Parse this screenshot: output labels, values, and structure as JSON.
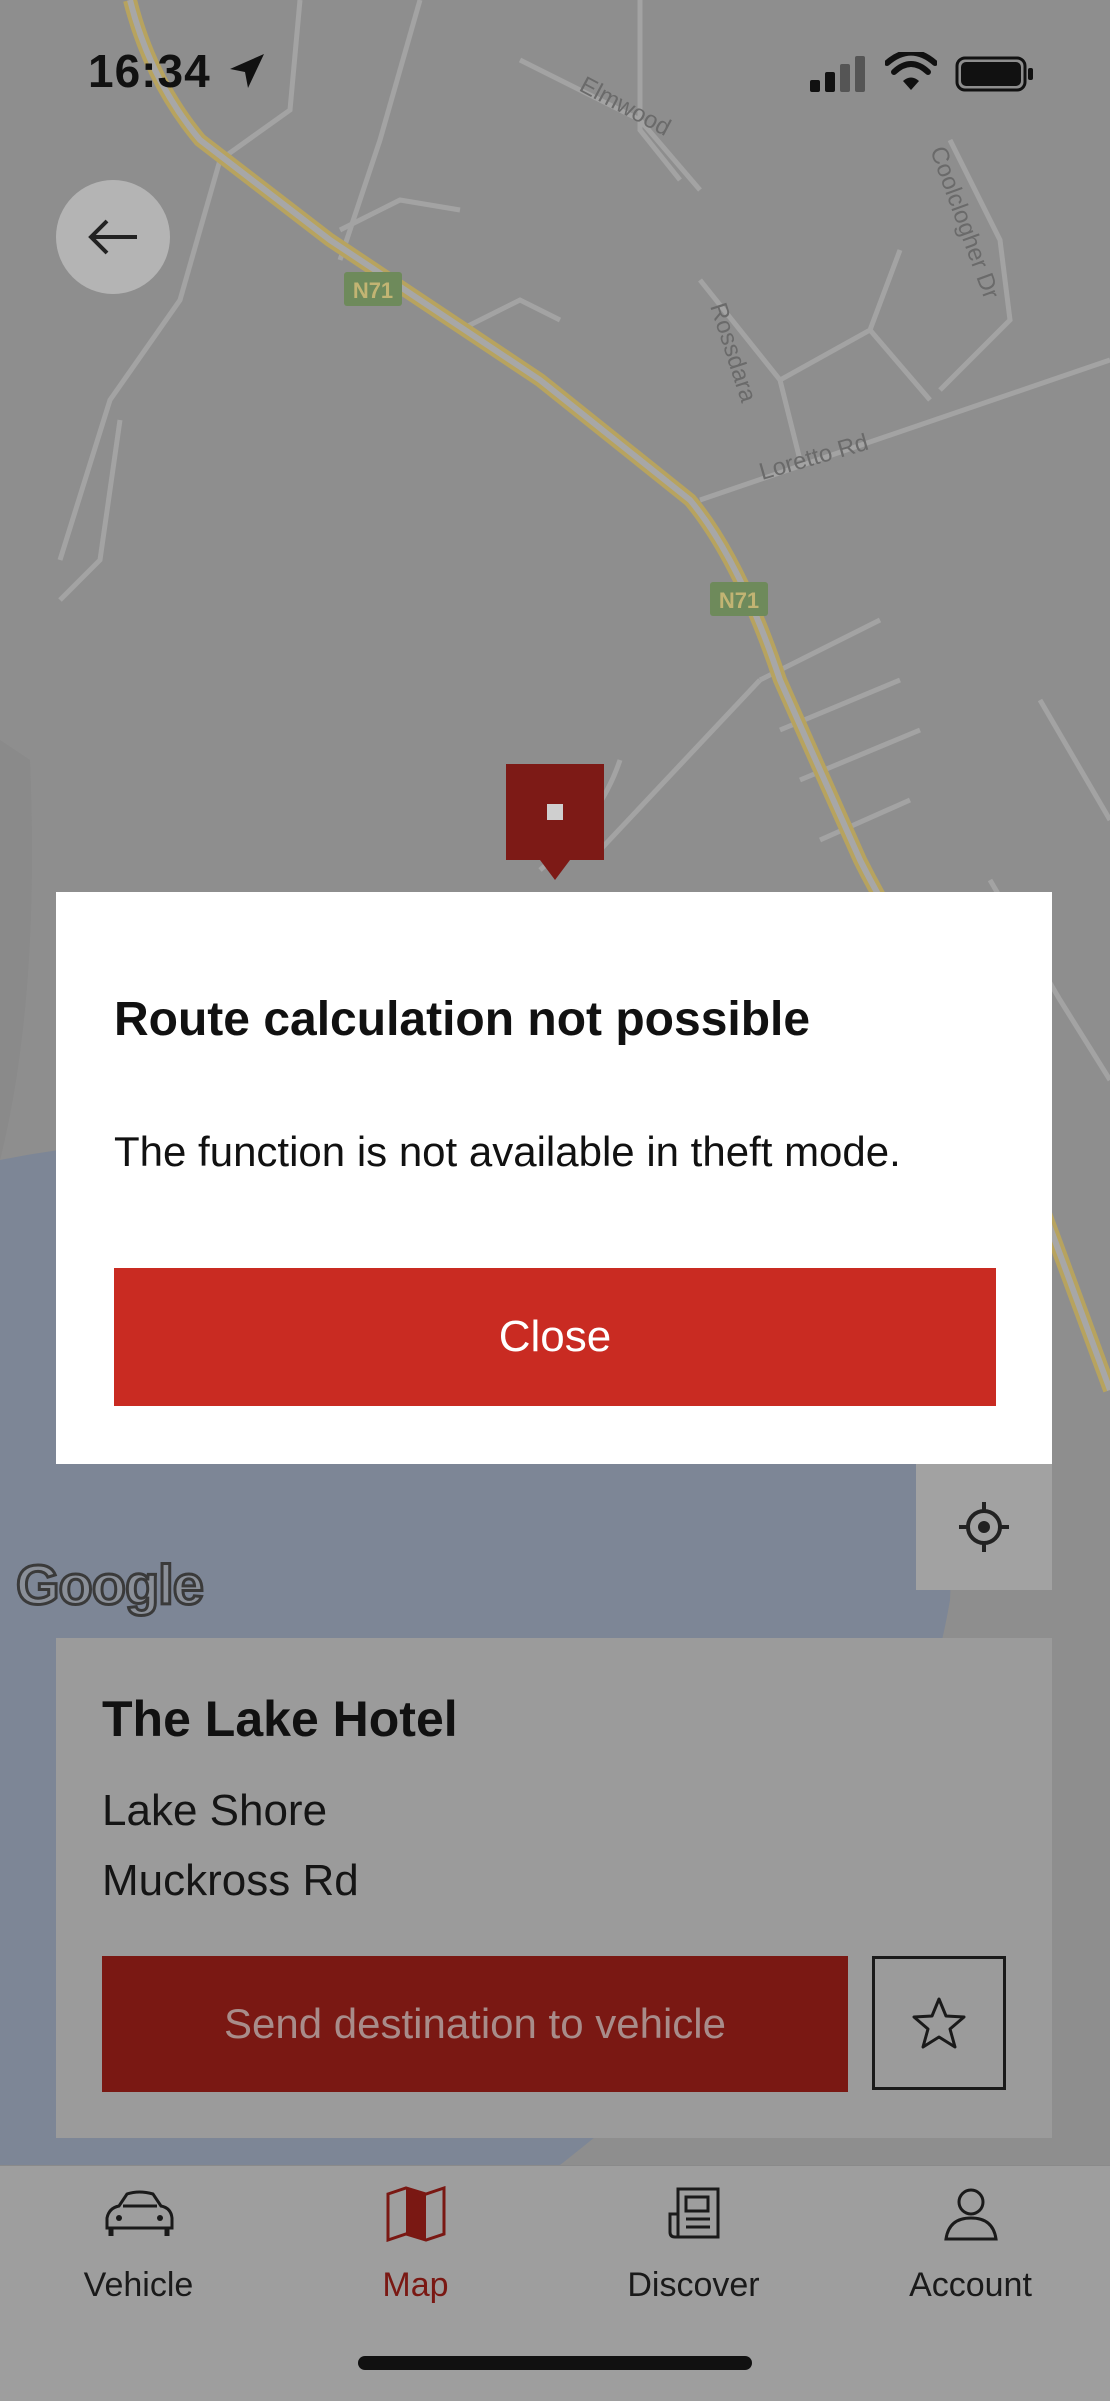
{
  "status_bar": {
    "time": "16:34"
  },
  "map": {
    "road_labels": {
      "elmwood": "Elmwood",
      "coolclogher": "Coolclogher Dr",
      "rossdara": "Rossdara",
      "loretto": "Loretto Rd",
      "n71_a": "N71",
      "n71_b": "N71"
    },
    "provider_logo": "Google"
  },
  "dialog": {
    "title": "Route calculation not possible",
    "message": "The function is not available in theft mode.",
    "close_label": "Close"
  },
  "destination": {
    "name": "The Lake Hotel",
    "address_line1": "Lake Shore",
    "address_line2": "Muckross Rd",
    "send_label": "Send destination to vehicle"
  },
  "tabs": [
    {
      "label": "Vehicle",
      "icon": "car-icon",
      "active": false
    },
    {
      "label": "Map",
      "icon": "map-icon",
      "active": true
    },
    {
      "label": "Discover",
      "icon": "news-icon",
      "active": false
    },
    {
      "label": "Account",
      "icon": "user-icon",
      "active": false
    }
  ],
  "colors": {
    "accent_red": "#c92b22",
    "dimmed_red": "#7a1813",
    "pin_red": "#7d1a16"
  }
}
